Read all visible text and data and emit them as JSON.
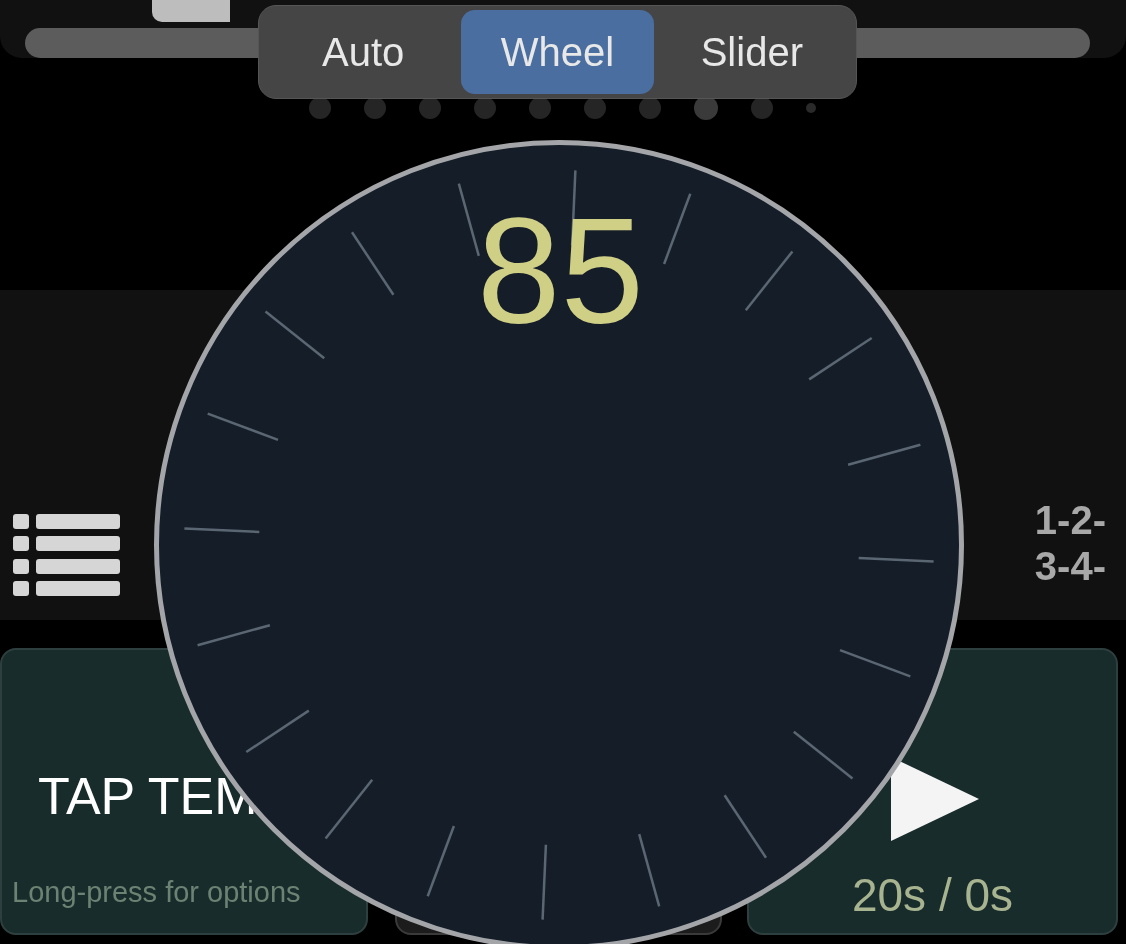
{
  "mode_tabs": [
    {
      "label": "Auto",
      "selected": false
    },
    {
      "label": "Wheel",
      "selected": true
    },
    {
      "label": "Slider",
      "selected": false
    }
  ],
  "page_dots": [
    {
      "kind": "dot",
      "selected": false
    },
    {
      "kind": "dot",
      "selected": false
    },
    {
      "kind": "dot",
      "selected": false
    },
    {
      "kind": "dot",
      "selected": false
    },
    {
      "kind": "dot",
      "selected": false
    },
    {
      "kind": "dot",
      "selected": false
    },
    {
      "kind": "dot",
      "selected": false
    },
    {
      "kind": "dot",
      "selected": true
    },
    {
      "kind": "dot",
      "selected": false
    },
    {
      "kind": "small",
      "selected": false
    }
  ],
  "dial": {
    "value": "85"
  },
  "beat_pattern": [
    "1-2-",
    "3-4-"
  ],
  "tap_button": {
    "label": "TAP TEM",
    "hint": "Long-press for options"
  },
  "play_button": {
    "timer": "20s / 0s"
  }
}
